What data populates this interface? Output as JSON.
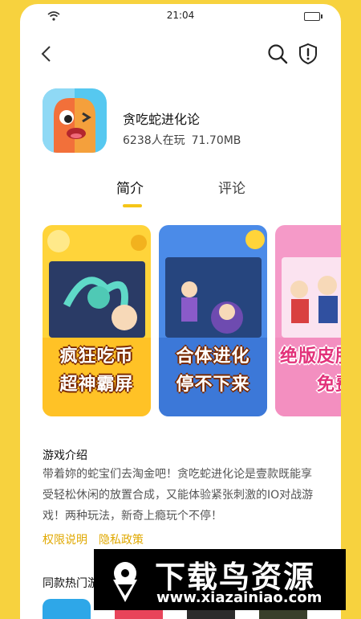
{
  "status_bar": {
    "time": "21:04"
  },
  "app": {
    "name": "贪吃蛇进化论",
    "players": "6238人在玩",
    "size": "71.70MB"
  },
  "tabs": [
    {
      "label": "简介",
      "active": true
    },
    {
      "label": "评论",
      "active": false
    }
  ],
  "screenshots": [
    {
      "caption_line1": "疯狂吃币",
      "caption_line2": "超神霸屏"
    },
    {
      "caption_line1": "合体进化",
      "caption_line2": "停不下来"
    },
    {
      "caption_line1": "绝版皮肤",
      "caption_line2": "免费"
    }
  ],
  "intro": {
    "title": "游戏介绍",
    "text": "带着妳的蛇宝们去淘金吧！贪吃蛇进化论是壹款既能享受轻松休闲的放置合成，又能体验紧张刺激的IO对战游戏！两种玩法，新奇上瘾玩个不停！"
  },
  "links": {
    "permissions": "权限说明",
    "privacy": "隐私政策"
  },
  "similar": {
    "title": "同款热门游"
  },
  "watermark": {
    "title": "下载鸟资源",
    "url": "www.xiazainiao.com"
  },
  "colors": {
    "accent": "#F5C518",
    "link": "#E0A800",
    "background": "#F7D23E"
  },
  "icons": [
    "back-icon",
    "search-icon",
    "shield-alert-icon",
    "wifi-icon",
    "battery-icon"
  ]
}
